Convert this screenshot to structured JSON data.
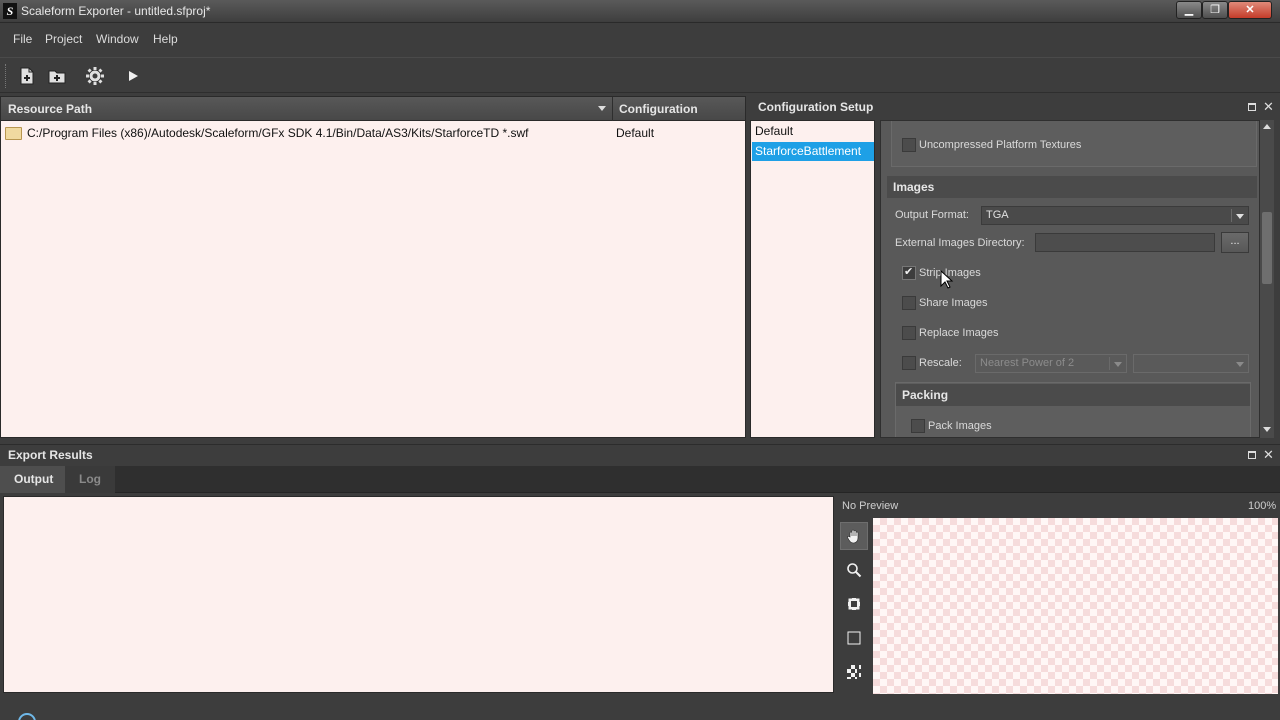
{
  "window": {
    "title": "Scaleform Exporter - untitled.sfproj*",
    "minimize": "▁",
    "restore": "❐",
    "close": "✕",
    "app_icon_letter": "S"
  },
  "menu": {
    "items": [
      {
        "label": "File"
      },
      {
        "label": "Project"
      },
      {
        "label": "Window"
      },
      {
        "label": "Help"
      }
    ]
  },
  "toolbar": {
    "icons": [
      "add-file-icon",
      "add-folder-icon",
      "settings-gear-icon",
      "play-icon"
    ]
  },
  "resource_panel": {
    "columns": {
      "path": "Resource Path",
      "configuration": "Configuration"
    },
    "rows": [
      {
        "path": "C:/Program Files (x86)/Autodesk/Scaleform/GFx SDK 4.1/Bin/Data/AS3/Kits/StarforceTD *.swf",
        "configuration": "Default"
      }
    ]
  },
  "config_setup": {
    "title": "Configuration Setup",
    "configs": [
      {
        "label": "Default",
        "selected": false
      },
      {
        "label": "StarforceBattlement",
        "selected": true
      }
    ],
    "uncompressed_textures": {
      "label": "Uncompressed Platform Textures",
      "checked": false
    },
    "images": {
      "title": "Images",
      "output_format_label": "Output Format:",
      "output_format_value": "TGA",
      "ext_dir_label": "External Images Directory:",
      "ext_dir_value": "",
      "browse_label": "...",
      "strip_images": {
        "label": "Strip Images",
        "checked": true
      },
      "share_images": {
        "label": "Share Images",
        "checked": false
      },
      "replace_images": {
        "label": "Replace Images",
        "checked": false
      },
      "rescale": {
        "label": "Rescale:",
        "checked": false,
        "mode_value": "Nearest Power of 2",
        "second_value": ""
      }
    },
    "packing": {
      "title": "Packing",
      "pack_images": {
        "label": "Pack Images",
        "checked": false
      }
    }
  },
  "export_results": {
    "title": "Export Results",
    "tabs": [
      {
        "label": "Output",
        "active": true
      },
      {
        "label": "Log",
        "active": false
      }
    ],
    "preview": {
      "status": "No Preview",
      "zoom": "100%"
    },
    "preview_tools": [
      "hand-icon",
      "magnifier-icon",
      "fit-icon",
      "actual-size-icon",
      "checker-icon"
    ]
  },
  "colors": {
    "accent": "#1ea0e6",
    "panel_bg": "#3d3d3d",
    "list_bg": "#fdf0ee"
  }
}
